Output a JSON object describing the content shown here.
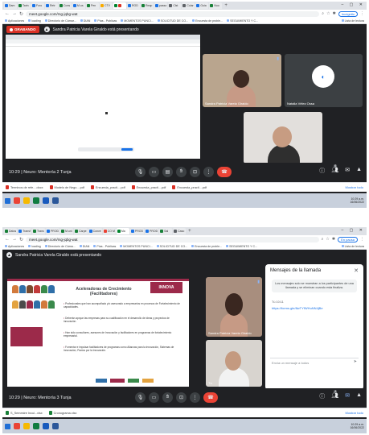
{
  "top": {
    "tabs": [
      "Dam",
      "Tarin",
      "Foro",
      "Retr",
      "Cons",
      "M.us",
      "Pen",
      "CTV",
      "",
      "",
      "",
      "ROD",
      "Reap",
      "passo",
      "Clst",
      "Colar",
      "Guia",
      "Nuo"
    ],
    "url": "meet.google.com/rsg-jqbg-wat",
    "incognito_label": "Incógnito",
    "bookmarks": [
      "Aplicaciones",
      "loading",
      "Directorio de Cámar...",
      "DIAN",
      "Pías - Publicas",
      "MOMENTOS PUNCI...",
      "SOLICITUD DE CO...",
      "Encuesta de proble...",
      "SEGUIMIENTO Y C..."
    ],
    "bookmarks_right": "Lista de lectura",
    "recording_label": "GRABANDO",
    "presenting_text": "Sandra Patricia Varela Giraldo está presentando",
    "participants": [
      {
        "name": "Sandra Patricia Varela Giraldo"
      },
      {
        "name": "Natalia Vélez Ossa"
      }
    ],
    "meeting_time": "10:29",
    "meeting_name": "Neuro: Mentoría 2 Tunja",
    "participant_count": "6",
    "downloads": [
      "Terminos de refe....docx",
      "Modelo de Nego....pdf",
      "Encuesta_practi....pdf",
      "Encuesta_practi....pdf",
      "Encuesta_practi....pdf"
    ],
    "downloads_more": "Mostrar todo",
    "clock_time": "10:29 a.m.",
    "clock_date": "16/06/2022"
  },
  "bottom": {
    "tabs": [
      "Datos",
      "Transf",
      "Trans",
      "PROD",
      "M.uni",
      "Carpe",
      "Conve",
      "CO M",
      "Ma",
      "",
      "PROD",
      "PROD",
      "Sal",
      "Caso"
    ],
    "url": "meet.google.com/rsg-jqbg-wat",
    "incognito_label": "En pausa",
    "bookmarks": [
      "Aplicaciones",
      "loading",
      "Directorio de Cáma...",
      "DIAN",
      "Pías - Publicas",
      "MOMENTOS PUNCI...",
      "SOLICITUD DE CO...",
      "Encuesta de proble...",
      "SEGUIMIENTO Y C..."
    ],
    "bookmarks_right": "Lista de lectura",
    "presenting_text": "Sandra Patricia Varela Giraldo está presentando",
    "slide": {
      "title": "Aceleradoras de Crecimiento (Facilitadores)",
      "logo": "INNOVA",
      "items": [
        "Profesionales que han acompañado y/o asesorado a empresarios en procesos de Fortalecimiento de capacidades.",
        "Deberán apoyar las empresas para su cualificación en el desarrollo de ideas y proyectos de innovación.",
        "Han sido consultores, asesores de Innovación y facilitadores en programas de fortalecimiento empresarial.",
        "Fomentar e impulsar facilitadores de programas como Alianzas para la innovación, Sistemas de Innovación, Pactos por la Innovación."
      ]
    },
    "participants": [
      {
        "name": "Sandra Patricia Varela Giraldo"
      },
      {
        "name": "Tú"
      }
    ],
    "chat": {
      "title": "Mensajes de la llamada",
      "note": "Los mensajes solo se muestran a los participantes de una llamada y se eliminan cuando esta finaliza.",
      "sender": "Tú  10:11",
      "link": "https://forms.gle/8wTYfWHuNN4jBe",
      "input_placeholder": "Envía un mensaje a todos"
    },
    "meeting_time": "10:29",
    "meeting_name": "Neuro: Mentoría 3 Tunja",
    "participant_count": "4",
    "downloads": [
      "S_Semestre Incul...xlsx",
      "Cronograma.xlsx"
    ],
    "downloads_more": "Mostrar todo",
    "clock_time": "10:29 a.m.",
    "clock_date": "16/06/2022"
  },
  "colors": {
    "meet_bg": "#202124",
    "tile_bg": "#3c4043",
    "hangup": "#ea4335",
    "record": "#d93025",
    "slide_accent": "#9c2a4a"
  }
}
